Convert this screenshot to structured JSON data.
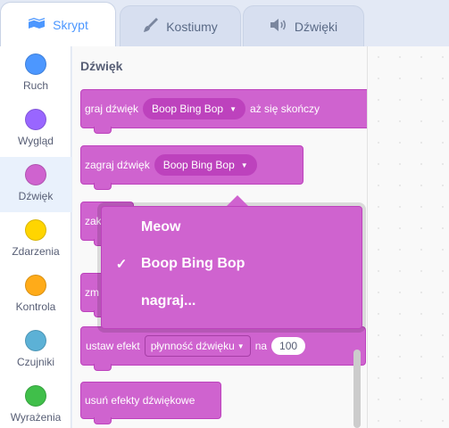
{
  "tabs": [
    {
      "label": "Skrypt",
      "icon": "code-icon"
    },
    {
      "label": "Kostiumy",
      "icon": "brush-icon"
    },
    {
      "label": "Dźwięki",
      "icon": "speaker-icon"
    }
  ],
  "categories": [
    {
      "label": "Ruch",
      "color": "#4c97ff"
    },
    {
      "label": "Wygląd",
      "color": "#9966ff"
    },
    {
      "label": "Dźwięk",
      "color": "#cf63cf"
    },
    {
      "label": "Zdarzenia",
      "color": "#ffd500"
    },
    {
      "label": "Kontrola",
      "color": "#ffab19"
    },
    {
      "label": "Czujniki",
      "color": "#5cb1d6"
    },
    {
      "label": "Wyrażenia",
      "color": "#40bf4a"
    }
  ],
  "palette": {
    "title": "Dźwięk",
    "blocks": {
      "play_until_done": {
        "prefix": "graj dźwięk",
        "sound": "Boop Bing Bop",
        "suffix": "aż się skończy"
      },
      "start_sound": {
        "prefix": "zagraj dźwięk",
        "sound": "Boop Bing Bop"
      },
      "stop_sounds_partial": "zak",
      "change_effect_partial": "zm",
      "set_effect": {
        "prefix": "ustaw efekt",
        "effect": "płynność dźwięku",
        "mid": "na",
        "value": "100"
      },
      "clear_effects": "usuń efekty dźwiękowe"
    }
  },
  "dropdown": {
    "options": [
      {
        "label": "Meow",
        "checked": false
      },
      {
        "label": "Boop Bing Bop",
        "checked": true
      },
      {
        "label": "nagraj...",
        "checked": false
      }
    ],
    "check_glyph": "✓"
  }
}
